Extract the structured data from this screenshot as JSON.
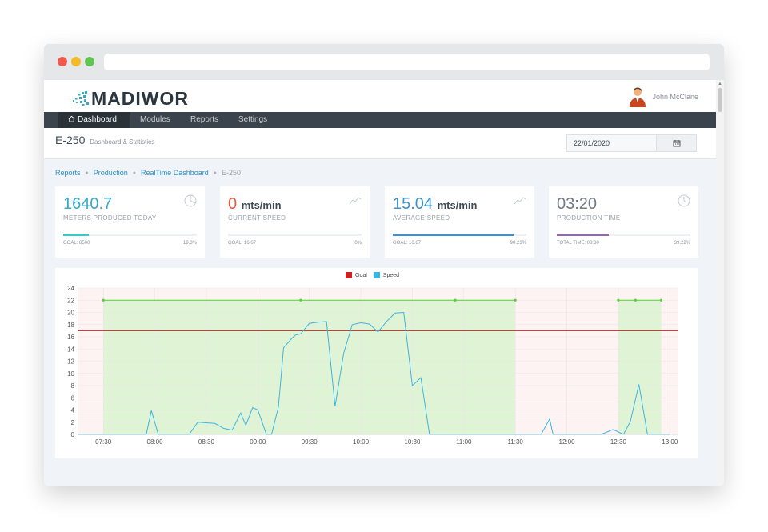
{
  "app": {
    "logo_text": "MADIWOR",
    "user_name": "John McClane"
  },
  "nav": {
    "items": [
      {
        "label": "Dashboard",
        "icon": "home-icon",
        "active": true
      },
      {
        "label": "Modules"
      },
      {
        "label": "Reports"
      },
      {
        "label": "Settings"
      }
    ]
  },
  "page": {
    "title": "E-250",
    "subtitle": "Dashboard & Statistics",
    "date": "22/01/2020",
    "date_icon": "calendar-icon"
  },
  "breadcrumb": [
    "Reports",
    "Production",
    "RealTime Dashboard",
    "E-250"
  ],
  "cards": [
    {
      "value": "1640.7",
      "unit": "",
      "label": "METERS PRODUCED TODAY",
      "goal": "GOAL: 8500",
      "pct": "19.3%",
      "progress": 0.193,
      "value_color": "#36a9c9",
      "bar_color": "#3ec6c1",
      "icon": "pie-chart-icon"
    },
    {
      "value": "0",
      "unit": "mts/min",
      "label": "CURRENT SPEED",
      "goal": "GOAL: 16.67",
      "pct": "0%",
      "progress": 0.0,
      "value_color": "#e8583c",
      "bar_color": "#e8583c",
      "icon": "trend-icon"
    },
    {
      "value": "15.04",
      "unit": "mts/min",
      "label": "AVERAGE SPEED",
      "goal": "GOAL: 16.67",
      "pct": "90.23%",
      "progress": 0.9023,
      "value_color": "#3b94c7",
      "bar_color": "#4a8cc4",
      "icon": "trend-icon"
    },
    {
      "value": "03:20",
      "unit": "",
      "label": "PRODUCTION TIME",
      "goal": "TOTAL TIME: 08:30",
      "pct": "39.22%",
      "progress": 0.3922,
      "value_color": "#6f7a86",
      "bar_color": "#8e6ca6",
      "icon": "clock-icon"
    }
  ],
  "chart_data": {
    "type": "line",
    "legend": [
      {
        "name": "Goal",
        "color": "#cc1f1f"
      },
      {
        "name": "Speed",
        "color": "#3bb6e0"
      }
    ],
    "ylim": [
      0,
      24
    ],
    "yticks": [
      0,
      2,
      4,
      6,
      8,
      10,
      12,
      14,
      16,
      18,
      20,
      22,
      24
    ],
    "xlim": [
      "07:15",
      "13:05"
    ],
    "xticks": [
      "07:30",
      "08:00",
      "08:30",
      "09:00",
      "09:30",
      "10:00",
      "10:30",
      "11:00",
      "11:30",
      "12:00",
      "12:30",
      "13:00"
    ],
    "goal_line": 17,
    "production_windows": [
      {
        "start": "07:30",
        "end": "11:30",
        "level": 22,
        "markers": [
          "07:30",
          "09:25",
          "10:55",
          "11:30"
        ]
      },
      {
        "start": "12:30",
        "end": "12:55",
        "level": 22,
        "markers": [
          "12:30",
          "12:40",
          "12:55"
        ]
      }
    ],
    "series": [
      {
        "name": "Speed",
        "x": [
          "07:15",
          "07:30",
          "07:40",
          "07:55",
          "07:58",
          "08:02",
          "08:10",
          "08:20",
          "08:25",
          "08:35",
          "08:40",
          "08:45",
          "08:50",
          "08:53",
          "08:57",
          "09:00",
          "09:05",
          "09:08",
          "09:12",
          "09:15",
          "09:20",
          "09:22",
          "09:25",
          "09:30",
          "09:35",
          "09:40",
          "09:45",
          "09:50",
          "09:55",
          "10:00",
          "10:05",
          "10:10",
          "10:15",
          "10:20",
          "10:25",
          "10:30",
          "10:35",
          "10:40",
          "10:45",
          "10:48",
          "10:52",
          "10:55",
          "10:58",
          "11:05",
          "11:15",
          "11:25",
          "11:35",
          "11:45",
          "11:50",
          "11:52",
          "12:00",
          "12:10",
          "12:20",
          "12:27",
          "12:33",
          "12:37",
          "12:42",
          "12:47",
          "12:52",
          "12:57",
          "13:00"
        ],
        "y": [
          0,
          0,
          0,
          0,
          3.9,
          0,
          0,
          0,
          2,
          1.8,
          1,
          0.7,
          3.5,
          1.5,
          4.4,
          4,
          0,
          0,
          4.5,
          14.2,
          15.8,
          16.3,
          16.5,
          18.2,
          18.4,
          18.5,
          4.6,
          13.3,
          18,
          18.3,
          18.1,
          16.8,
          18.5,
          19.9,
          20,
          8,
          9.3,
          0,
          0,
          0,
          0,
          0,
          0,
          0,
          0,
          0,
          0,
          0,
          2.5,
          0,
          0,
          0,
          0,
          0.8,
          0,
          2.1,
          8.2,
          0,
          0,
          0,
          0
        ]
      }
    ]
  }
}
